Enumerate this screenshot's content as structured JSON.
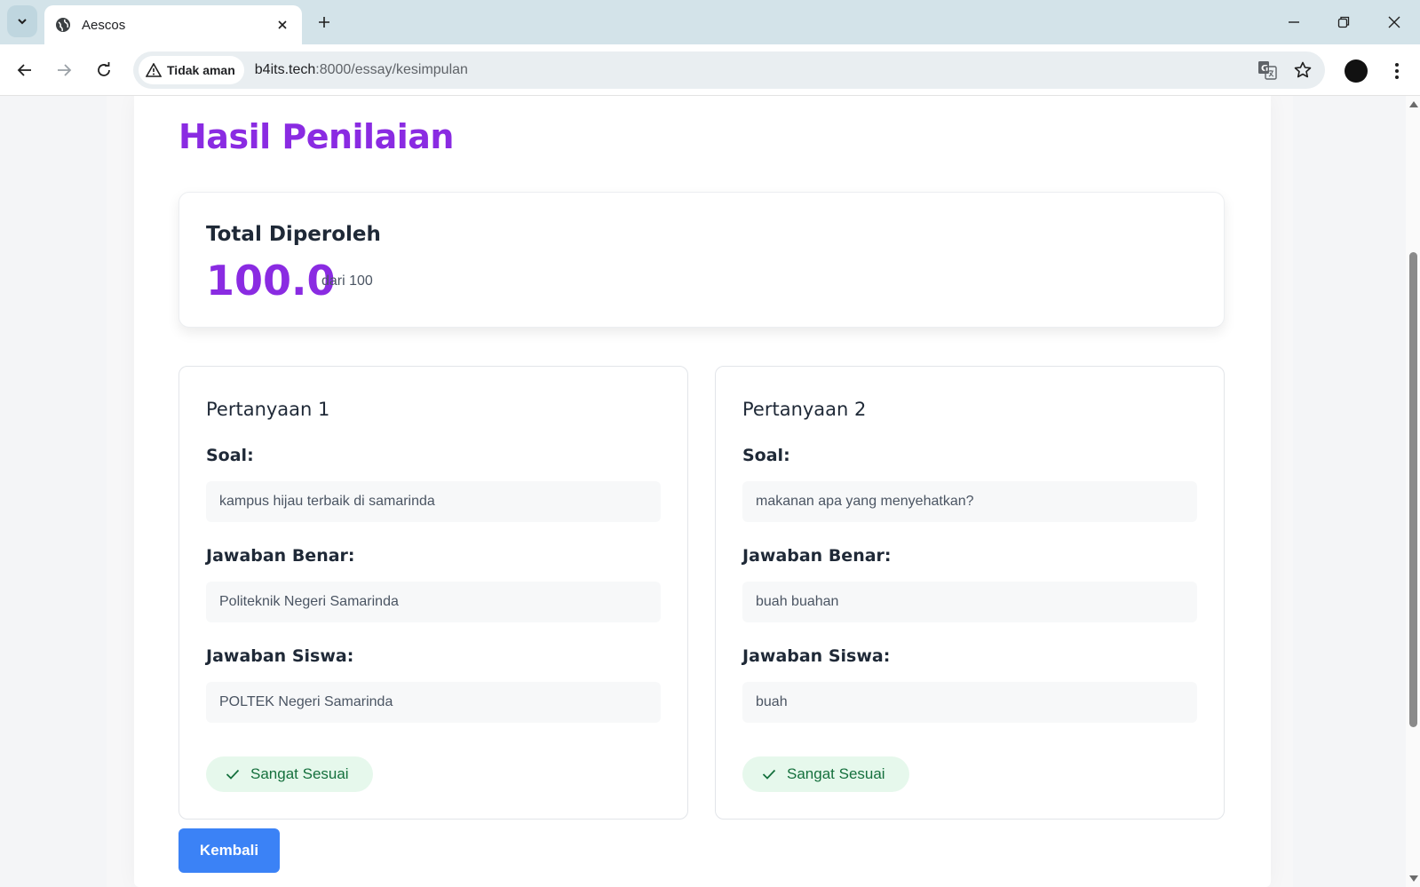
{
  "browser": {
    "tab_title": "Aescos",
    "security_label": "Tidak aman",
    "url_host": "b4its.tech",
    "url_rest": ":8000/essay/kesimpulan",
    "icons": {
      "tab_search": "chevron-down-icon",
      "favicon": "globe-icon",
      "close": "close-icon",
      "new_tab": "plus-icon",
      "minimize": "minimize-icon",
      "restore": "restore-icon",
      "window_close": "close-icon",
      "back": "arrow-left-icon",
      "forward": "arrow-right-icon",
      "reload": "reload-icon",
      "warning": "warning-icon",
      "translate": "translate-icon",
      "bookmark": "star-icon",
      "menu": "kebab-menu-icon"
    }
  },
  "page": {
    "title": "Hasil Penilaian",
    "total": {
      "label": "Total Diperoleh",
      "score": "100.0",
      "max": "dari 100"
    },
    "questions": [
      {
        "title": "Pertanyaan 1",
        "soal_label": "Soal:",
        "soal": "kampus hijau terbaik di samarinda",
        "benar_label": "Jawaban Benar:",
        "benar": "Politeknik Negeri Samarinda",
        "siswa_label": "Jawaban Siswa:",
        "siswa": "POLTEK Negeri Samarinda",
        "status": "Sangat Sesuai"
      },
      {
        "title": "Pertanyaan 2",
        "soal_label": "Soal:",
        "soal": "makanan apa yang menyehatkan?",
        "benar_label": "Jawaban Benar:",
        "benar": "buah buahan",
        "siswa_label": "Jawaban Siswa:",
        "siswa": "buah",
        "status": "Sangat Sesuai"
      }
    ],
    "back_button": "Kembali"
  },
  "colors": {
    "accent": "#8a2be2",
    "primary_button": "#3b82f6",
    "status_bg": "#e6f8ec",
    "status_text": "#15703d"
  }
}
